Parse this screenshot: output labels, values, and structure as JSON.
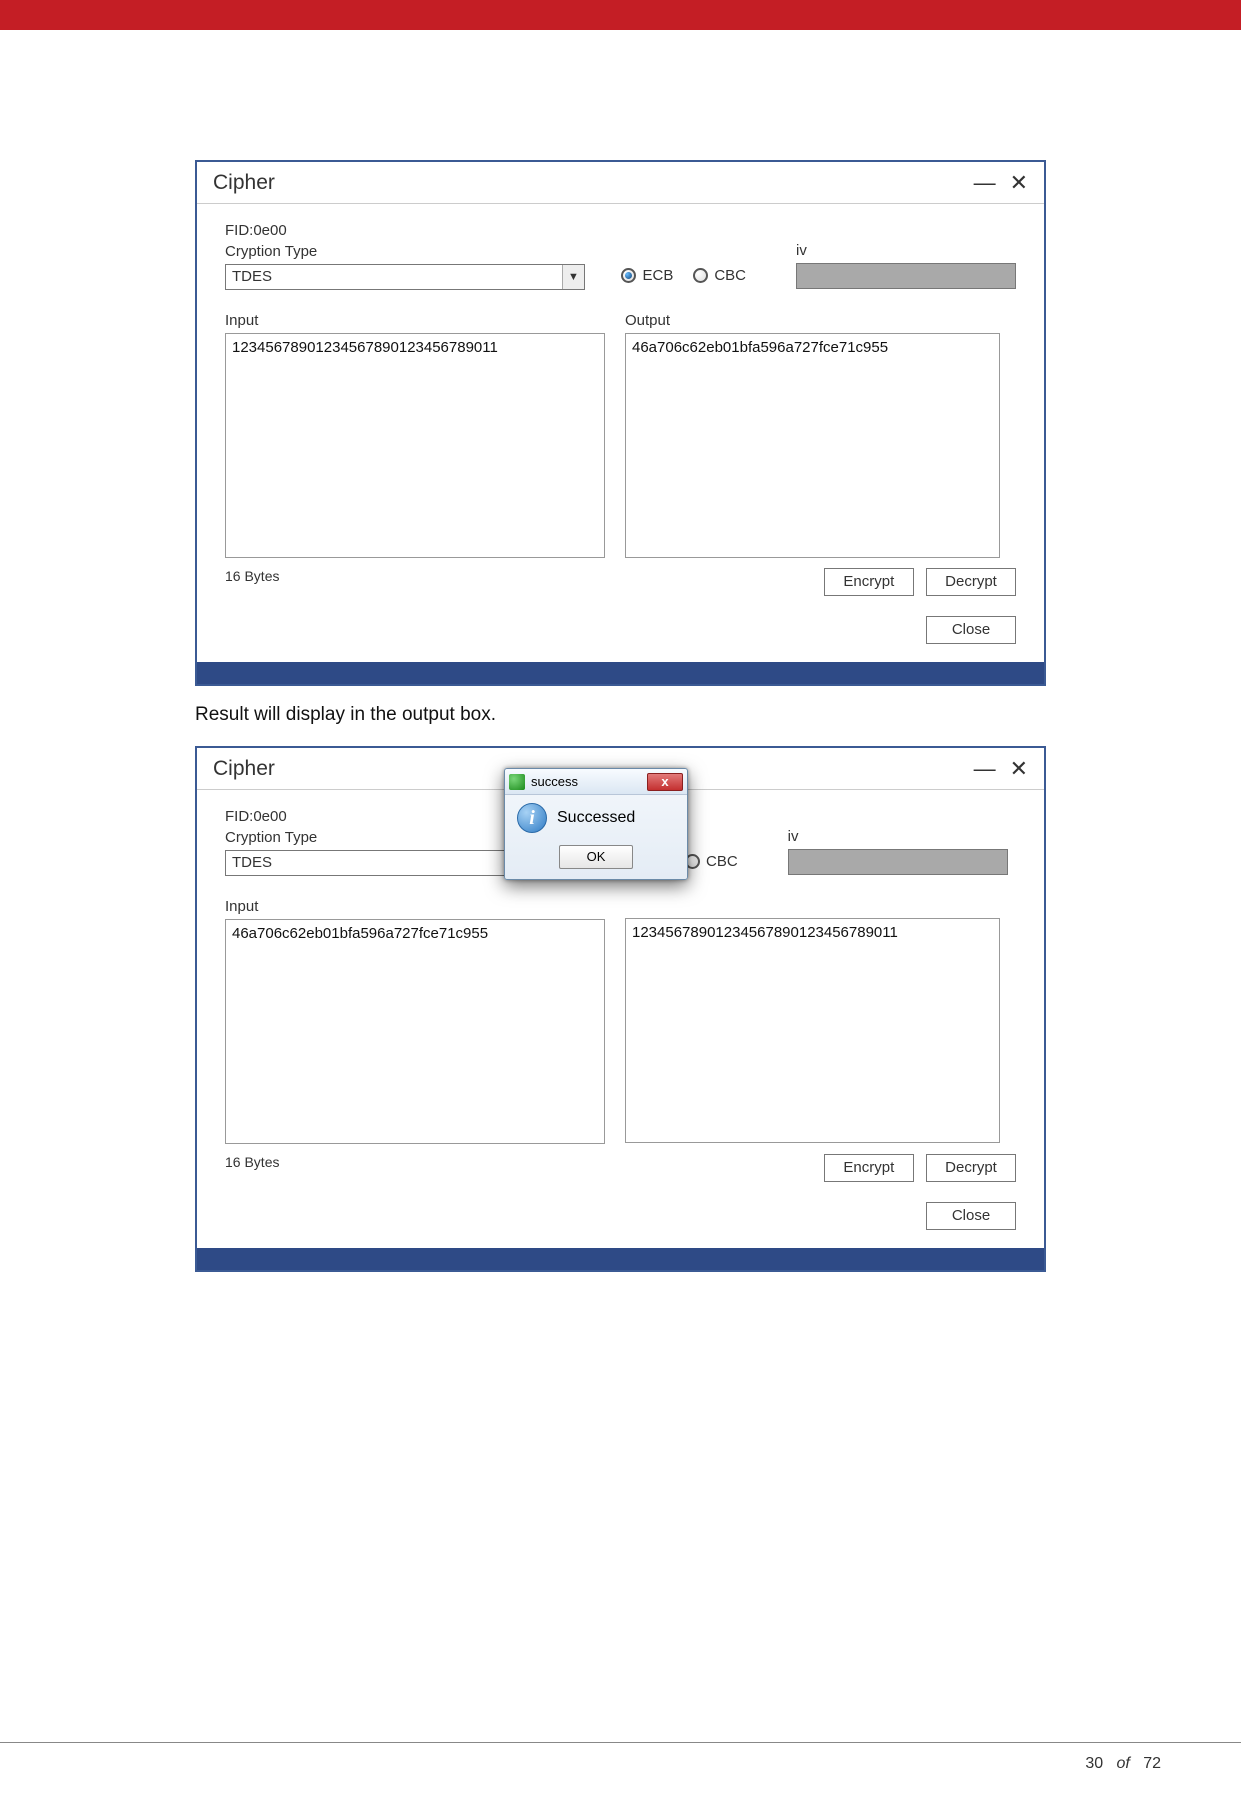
{
  "page": {
    "caption": "Result will display in the output box.",
    "footer_page": "30",
    "footer_of": "of",
    "footer_total": "72"
  },
  "win1": {
    "title": "Cipher",
    "fid_label": "FID:0e00",
    "cryption_label": "Cryption Type",
    "cryption_value": "TDES",
    "mode_ecb": "ECB",
    "mode_cbc": "CBC",
    "iv_label": "iv",
    "input_label": "Input",
    "input_value": "12345678901234567890123456789011",
    "output_label": "Output",
    "output_value": "46a706c62eb01bfa596a727fce71c955",
    "bytes": "16 Bytes",
    "encrypt": "Encrypt",
    "decrypt": "Decrypt",
    "close": "Close"
  },
  "win2": {
    "title": "Cipher",
    "fid_label": "FID:0e00",
    "cryption_label": "Cryption Type",
    "cryption_value": "TDES",
    "mode_cbc": "CBC",
    "iv_label": "iv",
    "input_label": "Input",
    "input_value": "46a706c62eb01bfa596a727fce71c955",
    "output_value": "12345678901234567890123456789011",
    "bytes": "16 Bytes",
    "encrypt": "Encrypt",
    "decrypt": "Decrypt",
    "close": "Close"
  },
  "msg": {
    "title": "success",
    "body": "Successed",
    "ok": "OK"
  }
}
